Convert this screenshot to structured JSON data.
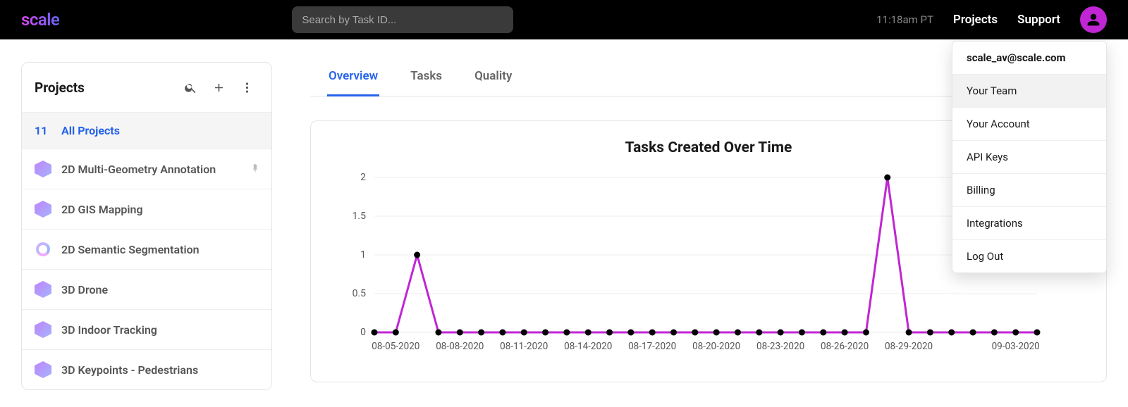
{
  "header": {
    "logo": "scale",
    "search_placeholder": "Search by Task ID...",
    "time": "11:18am PT",
    "nav": {
      "projects": "Projects",
      "support": "Support"
    }
  },
  "dropdown": {
    "email": "scale_av@scale.com",
    "items": [
      {
        "label": "Your Team",
        "hover": true
      },
      {
        "label": "Your Account",
        "hover": false
      },
      {
        "label": "API Keys",
        "hover": false
      },
      {
        "label": "Billing",
        "hover": false
      },
      {
        "label": "Integrations",
        "hover": false
      },
      {
        "label": "Log Out",
        "hover": false
      }
    ]
  },
  "sidebar": {
    "title": "Projects",
    "all_count": "11",
    "all_label": "All Projects",
    "projects": [
      {
        "label": "2D Multi-Geometry Annotation",
        "icon": "hex",
        "pinned": true
      },
      {
        "label": "2D GIS Mapping",
        "icon": "hex",
        "pinned": false
      },
      {
        "label": "2D Semantic Segmentation",
        "icon": "circle",
        "pinned": false
      },
      {
        "label": "3D Drone",
        "icon": "hex",
        "pinned": false
      },
      {
        "label": "3D Indoor Tracking",
        "icon": "hex",
        "pinned": false
      },
      {
        "label": "3D Keypoints - Pedestrians",
        "icon": "hex",
        "pinned": false
      }
    ]
  },
  "tabs": {
    "overview": "Overview",
    "tasks": "Tasks",
    "quality": "Quality"
  },
  "chart_data": {
    "type": "line",
    "title": "Tasks Created Over Time",
    "ylabel": "",
    "xlabel": "",
    "ylim": [
      0,
      2
    ],
    "y_ticks": [
      0,
      0.5,
      1,
      1.5,
      2
    ],
    "x_tick_labels": [
      "08-05-2020",
      "08-08-2020",
      "08-11-2020",
      "08-14-2020",
      "08-17-2020",
      "08-20-2020",
      "08-23-2020",
      "08-26-2020",
      "08-29-2020",
      "09-03-2020"
    ],
    "categories": [
      "08-04-2020",
      "08-05-2020",
      "08-06-2020",
      "08-07-2020",
      "08-08-2020",
      "08-09-2020",
      "08-10-2020",
      "08-11-2020",
      "08-12-2020",
      "08-13-2020",
      "08-14-2020",
      "08-15-2020",
      "08-16-2020",
      "08-17-2020",
      "08-18-2020",
      "08-19-2020",
      "08-20-2020",
      "08-21-2020",
      "08-22-2020",
      "08-23-2020",
      "08-24-2020",
      "08-25-2020",
      "08-26-2020",
      "08-27-2020",
      "08-28-2020",
      "08-29-2020",
      "08-30-2020",
      "08-31-2020",
      "09-01-2020",
      "09-02-2020",
      "09-03-2020",
      "09-04-2020"
    ],
    "values": [
      0,
      0,
      1,
      0,
      0,
      0,
      0,
      0,
      0,
      0,
      0,
      0,
      0,
      0,
      0,
      0,
      0,
      0,
      0,
      0,
      0,
      0,
      0,
      0,
      2,
      0,
      0,
      0,
      0,
      0,
      0,
      0
    ],
    "line_color": "#c026d3",
    "marker_color": "#000000"
  }
}
